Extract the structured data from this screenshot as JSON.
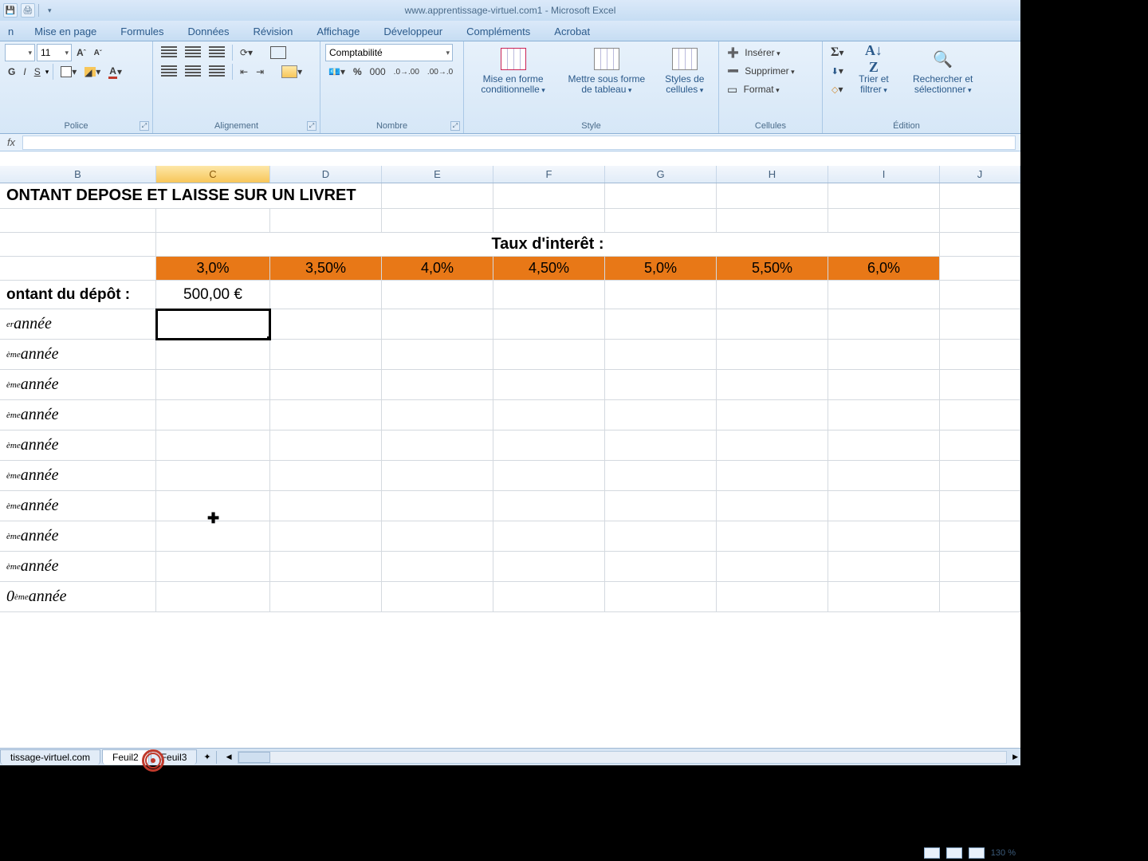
{
  "titlebar": {
    "title": "www.apprentissage-virtuel.com1 - Microsoft Excel"
  },
  "ribbon_tabs": [
    "n",
    "Mise en page",
    "Formules",
    "Données",
    "Révision",
    "Affichage",
    "Développeur",
    "Compléments",
    "Acrobat"
  ],
  "ribbon": {
    "police": {
      "label": "Police",
      "font_name": "",
      "font_size": "11",
      "bold": "G",
      "italic": "I",
      "underline": "S"
    },
    "alignement": {
      "label": "Alignement"
    },
    "nombre": {
      "label": "Nombre",
      "format": "Comptabilité",
      "percent": "%",
      "thousand": "000"
    },
    "style": {
      "label": "Style",
      "cond": "Mise en forme conditionnelle",
      "table": "Mettre sous forme de tableau",
      "cell": "Styles de cellules"
    },
    "cellules": {
      "label": "Cellules",
      "insert": "Insérer",
      "delete": "Supprimer",
      "format": "Format"
    },
    "edition": {
      "label": "Édition",
      "sigma": "Σ",
      "sort": "Trier et filtrer",
      "find": "Rechercher et sélectionner"
    }
  },
  "formula_bar": {
    "fx": "fx",
    "value": ""
  },
  "columns": [
    "B",
    "C",
    "D",
    "E",
    "F",
    "G",
    "H",
    "I",
    "J"
  ],
  "sheet": {
    "title": "ONTANT DEPOSE ET LAISSE SUR UN LIVRET",
    "interest_heading": "Taux d'interêt :",
    "rates": [
      "3,0%",
      "3,50%",
      "4,0%",
      "4,50%",
      "5,0%",
      "5,50%",
      "6,0%"
    ],
    "deposit_label": "ontant du dépôt :",
    "deposit_value": "500,00 €",
    "years": [
      {
        "sup": "er",
        "txt": " année"
      },
      {
        "sup": "ème",
        "txt": " année"
      },
      {
        "sup": "ème",
        "txt": " année"
      },
      {
        "sup": "ème",
        "txt": " année"
      },
      {
        "sup": "ème",
        "txt": " année"
      },
      {
        "sup": "ème",
        "txt": " année"
      },
      {
        "sup": "ème",
        "txt": " année"
      },
      {
        "sup": "ème",
        "txt": " année"
      },
      {
        "sup": "ème",
        "txt": " année"
      },
      {
        "sup": "ème",
        "txt": " année",
        "pre": "0"
      }
    ]
  },
  "sheet_tabs": {
    "tab1": "tissage-virtuel.com",
    "tab2": "Feuil2",
    "tab3": "Feuil3"
  },
  "status": {
    "zoom": "130 %"
  }
}
